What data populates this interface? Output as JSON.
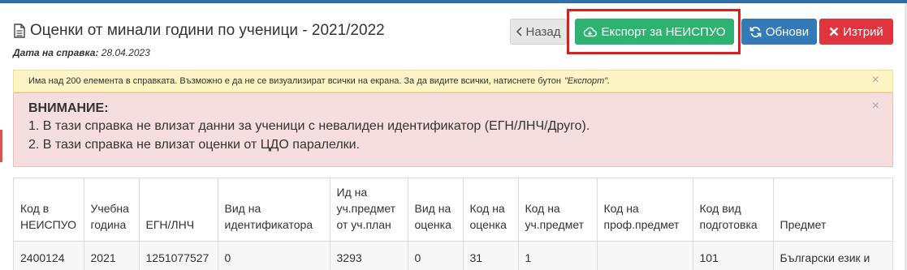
{
  "page": {
    "title": "Оценки от минали години по ученици - 2021/2022",
    "date_label": "Дата на справка:",
    "date_value": "28.04.2023"
  },
  "buttons": {
    "back": "Назад",
    "export": "Експорт за НЕИСПУО",
    "refresh": "Обнови",
    "delete": "Изтрий"
  },
  "warning": {
    "text": "Има над 200 елемента в справката. Възможно е да не се визуализират всички на екрана. За да видите всички, натиснете бутон",
    "emphasis": "\"Експорт\".",
    "close": "×"
  },
  "danger": {
    "heading": "ВНИМАНИЕ:",
    "line1": "1. В тази справка не влизат данни за ученици с невалиден идентификатор (ЕГН/ЛНЧ/Друго).",
    "line2": "2. В тази справка не влизат оценки от ЦДО паралелки.",
    "close": "×"
  },
  "table": {
    "headers": [
      [
        "Код в",
        "НЕИСПУО"
      ],
      [
        "Учебна",
        "година"
      ],
      [
        "ЕГН/ЛНЧ"
      ],
      [
        "Вид на",
        "идентификатора"
      ],
      [
        "Ид на",
        "уч.предмет",
        "от уч.план"
      ],
      [
        "Вид на",
        "оценка"
      ],
      [
        "Код на",
        "оценка"
      ],
      [
        "Код на",
        "уч.предмет"
      ],
      [
        "Код на",
        "проф.предмет"
      ],
      [
        "Код вид",
        "подготовка"
      ],
      [
        "Предмет"
      ]
    ],
    "rows": [
      [
        "2400124",
        "2021",
        "1251077527",
        "0",
        "3293",
        "0",
        "31",
        "1",
        "",
        "101",
        "Български език и литература"
      ]
    ]
  },
  "colors": {
    "export": "#2db36f",
    "refresh": "#337ab7",
    "delete": "#e0353f",
    "back": "#e6e6e6",
    "warning_bg": "#fcf4c3",
    "danger_bg": "#f5dedd",
    "highlight": "#e11b1b"
  },
  "icons": {
    "title": "document-icon",
    "back": "chevron-left-icon",
    "export": "cloud-download-icon",
    "refresh": "refresh-icon",
    "delete": "close-icon"
  }
}
